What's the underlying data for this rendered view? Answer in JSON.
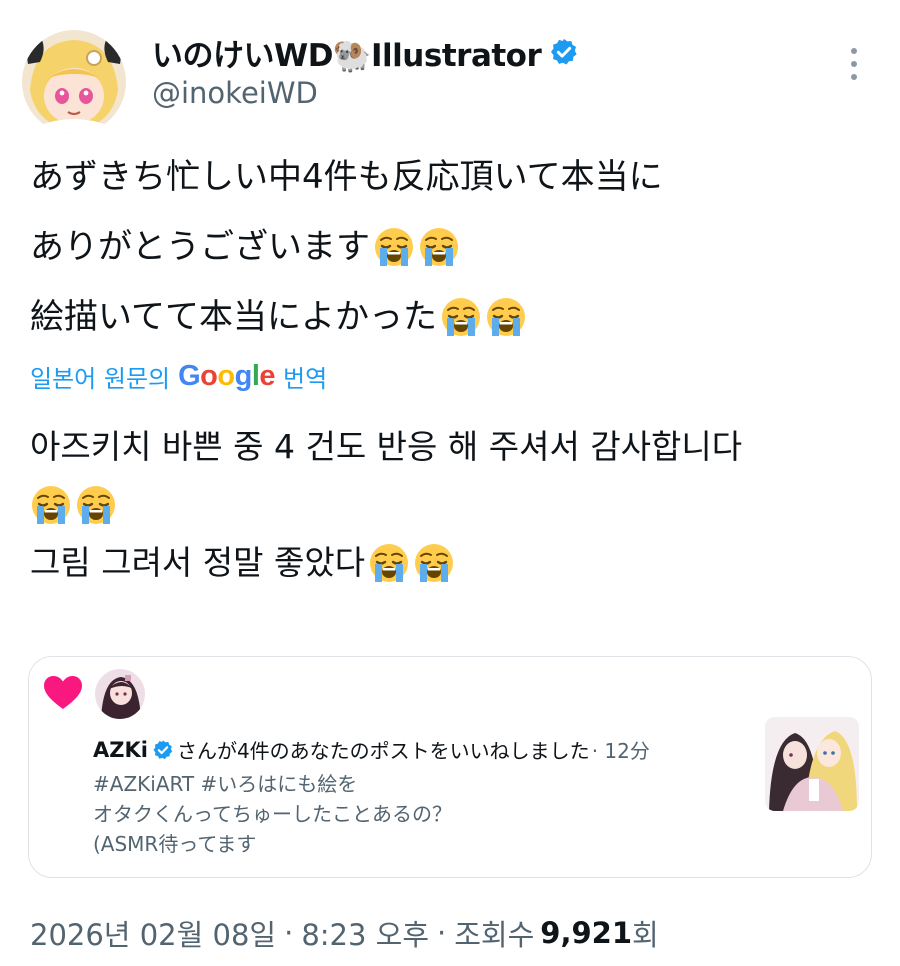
{
  "author": {
    "display_name": "いのけいWD🐏Illustrator",
    "handle": "@inokeiWD",
    "verified": true
  },
  "post": {
    "lines": [
      "あずきち忙しい中4件も反応頂いて本当に",
      "ありがとうございます",
      "絵描いてて本当によかった"
    ],
    "line_emojis": [
      "",
      "crying-face-emoji x2",
      "crying-face-emoji x2"
    ]
  },
  "translation": {
    "prefix": "일본어 원문의",
    "suffix": "번역",
    "google": [
      "G",
      "o",
      "o",
      "g",
      "l",
      "e"
    ]
  },
  "translated": {
    "lines": [
      "아즈키치 바쁜 중 4 건도 반응 해 주셔서 감사합니다",
      "",
      "그림 그려서 정말 좋았다 "
    ]
  },
  "notification": {
    "user": "AZKi",
    "text": "さんが4件のあなたのポストをいいねしました",
    "time": " · 12分",
    "quote_lines": [
      "#AZKiART #いろはにも絵を",
      "オタクくんってちゅーしたことあるの？",
      "(ASMR待ってます"
    ],
    "heart_color": "#f91880"
  },
  "meta": {
    "date": "2026년 02월 08일",
    "separator": "·",
    "time": "8:23 오후",
    "views_label": "조회수",
    "views": "9,921",
    "views_suffix": "회"
  },
  "colors": {
    "accent": "#1d9bf0",
    "text": "#0f1419",
    "secondary": "#536471",
    "verified": "#1d9bf0"
  }
}
